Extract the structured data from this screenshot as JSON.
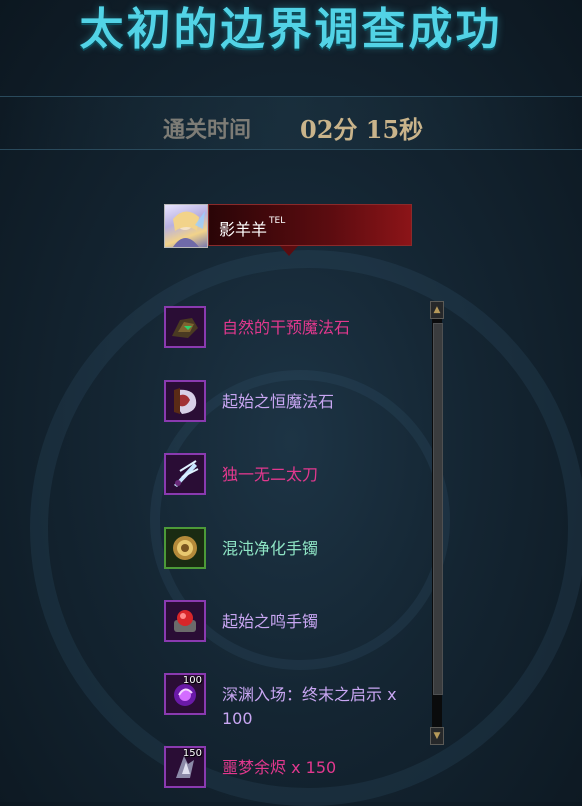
{
  "title": "太初的边界调查成功",
  "clear_time": {
    "label": "通关时间",
    "value": "02分 15秒"
  },
  "player": {
    "name": "影羊羊",
    "tag": "TEL"
  },
  "rewards": [
    {
      "name": "自然的干预魔法石",
      "color": "#e2388e",
      "icon": "magic-stone-icon",
      "count": ""
    },
    {
      "name": "起始之恒魔法石",
      "color": "#c8a6f2",
      "icon": "magic-stone-icon",
      "count": ""
    },
    {
      "name": "独一无二太刀",
      "color": "#e2388e",
      "icon": "katana-icon",
      "count": ""
    },
    {
      "name": "混沌净化手镯",
      "color": "#8ee4c4",
      "icon": "bracelet-icon",
      "count": ""
    },
    {
      "name": "起始之鸣手镯",
      "color": "#c8a6f2",
      "icon": "bracelet-icon",
      "count": ""
    },
    {
      "name": "深渊入场：终末之启示 x 100",
      "color": "#c8a6f2",
      "icon": "abyss-ticket-icon",
      "count": "100"
    },
    {
      "name": "噩梦余烬 x 150",
      "color": "#e2388e",
      "icon": "ember-icon",
      "count": "150"
    }
  ]
}
